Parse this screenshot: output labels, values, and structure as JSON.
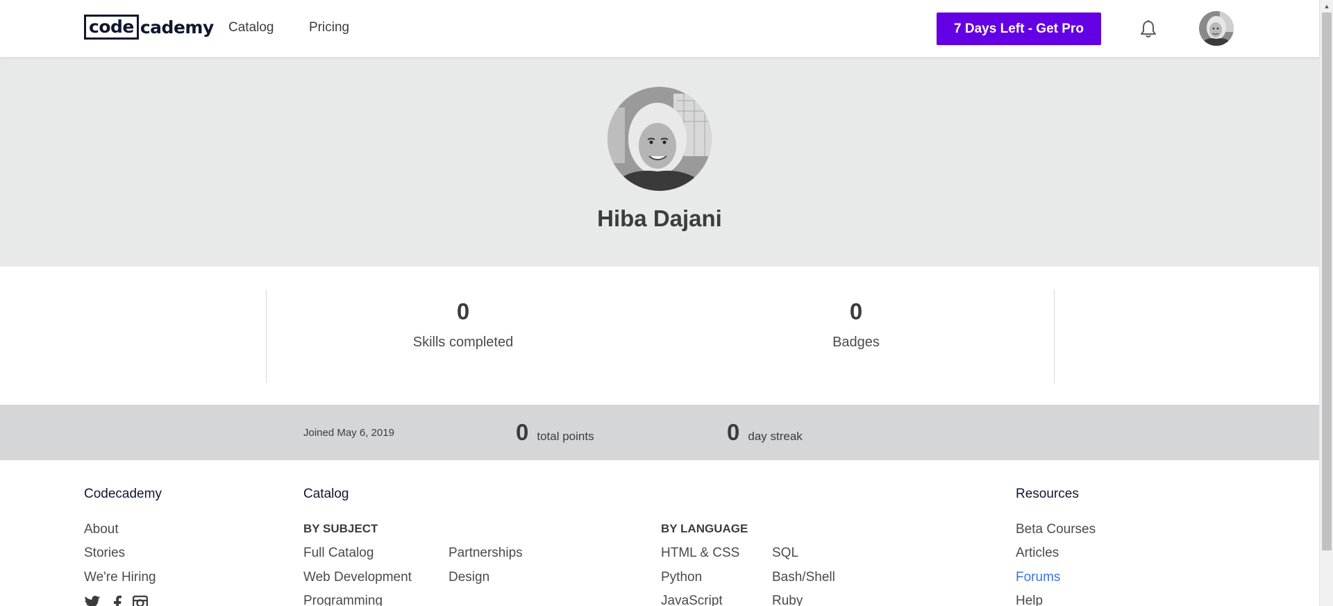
{
  "header": {
    "logo_boxed": "code",
    "logo_rest": "cademy",
    "nav": [
      {
        "label": "Catalog"
      },
      {
        "label": "Pricing"
      }
    ],
    "pro_button": "7 Days Left - Get Pro",
    "icons": {
      "notifications": "bell-icon",
      "avatar": "user-avatar"
    }
  },
  "profile": {
    "name": "Hiba Dajani"
  },
  "stats": [
    {
      "value": "0",
      "label": "Skills completed"
    },
    {
      "value": "0",
      "label": "Badges"
    }
  ],
  "info": {
    "joined": "Joined May 6, 2019",
    "points_value": "0",
    "points_label": "total points",
    "streak_value": "0",
    "streak_label": "day streak"
  },
  "footer": {
    "codecademy": {
      "heading": "Codecademy",
      "links": [
        "About",
        "Stories",
        "We're Hiring"
      ]
    },
    "catalog": {
      "heading": "Catalog",
      "by_subject": "BY SUBJECT",
      "subject_col1": [
        "Full Catalog",
        "Web Development",
        "Programming"
      ],
      "subject_col2": [
        "Partnerships",
        "Design"
      ],
      "by_language": "BY LANGUAGE",
      "lang_col1": [
        "HTML & CSS",
        "Python",
        "JavaScript"
      ],
      "lang_col2": [
        "SQL",
        "Bash/Shell",
        "Ruby"
      ]
    },
    "resources": {
      "heading": "Resources",
      "links": [
        "Beta Courses",
        "Articles",
        "Forums",
        "Help"
      ]
    },
    "social_icons": [
      "twitter-icon",
      "facebook-icon",
      "instagram-icon"
    ]
  },
  "colors": {
    "pro_purple": "#6400e4",
    "navy": "#10162f",
    "hero_bg": "#e8e9e9",
    "strip_bg": "#d5d6d8",
    "link_blue": "#3a72e8"
  }
}
